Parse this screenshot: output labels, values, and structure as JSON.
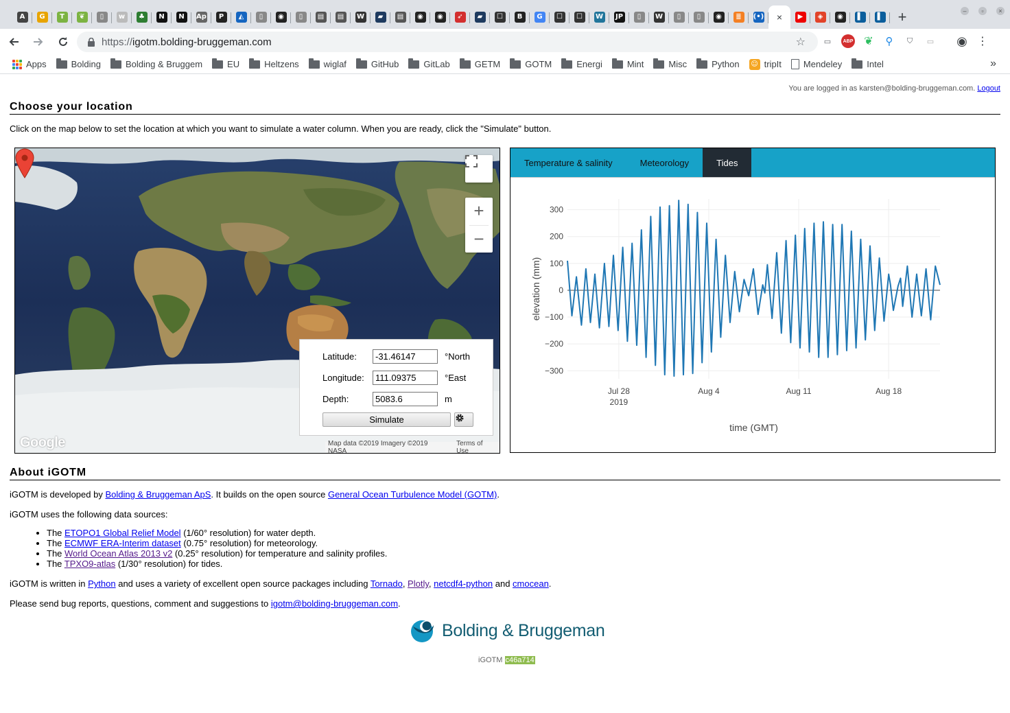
{
  "browser": {
    "tabs": [
      {
        "icon": "A",
        "color": "#444"
      },
      {
        "icon": "G",
        "color": "#e8a400"
      },
      {
        "icon": "T",
        "color": "#7cb342"
      },
      {
        "icon": "❦",
        "color": "#7cb342"
      },
      {
        "icon": "▯",
        "color": "#888"
      },
      {
        "icon": "w",
        "color": "#bbb"
      },
      {
        "icon": "♣",
        "color": "#2e7d32"
      },
      {
        "icon": "N",
        "color": "#111"
      },
      {
        "icon": "N",
        "color": "#111"
      },
      {
        "icon": "Ap",
        "color": "#666"
      },
      {
        "icon": "P",
        "color": "#222"
      },
      {
        "icon": "◭",
        "color": "#1565c0"
      },
      {
        "icon": "▯",
        "color": "#888"
      },
      {
        "icon": "◉",
        "color": "#222"
      },
      {
        "icon": "▯",
        "color": "#888"
      },
      {
        "icon": "▤",
        "color": "#555"
      },
      {
        "icon": "▤",
        "color": "#555"
      },
      {
        "icon": "W",
        "color": "#333"
      },
      {
        "icon": "▰",
        "color": "#1e3a5f"
      },
      {
        "icon": "▤",
        "color": "#555"
      },
      {
        "icon": "◉",
        "color": "#222"
      },
      {
        "icon": "◉",
        "color": "#222"
      },
      {
        "icon": "➶",
        "color": "#d32f2f"
      },
      {
        "icon": "▰",
        "color": "#1e3a5f"
      },
      {
        "icon": "☐",
        "color": "#333"
      },
      {
        "icon": "B",
        "color": "#222"
      },
      {
        "icon": "G",
        "color": "#4285f4"
      },
      {
        "icon": "☐",
        "color": "#333"
      },
      {
        "icon": "☐",
        "color": "#333"
      },
      {
        "icon": "W",
        "color": "#21759b"
      },
      {
        "icon": "JP",
        "color": "#111"
      },
      {
        "icon": "▯",
        "color": "#888"
      },
      {
        "icon": "W",
        "color": "#333"
      },
      {
        "icon": "▯",
        "color": "#888"
      },
      {
        "icon": "▯",
        "color": "#888"
      },
      {
        "icon": "◉",
        "color": "#222"
      },
      {
        "icon": "≣",
        "color": "#f48024"
      },
      {
        "icon": "(•)",
        "color": "#1565c0"
      }
    ],
    "tabs_after_active": [
      {
        "icon": "▶",
        "color": "#e00"
      },
      {
        "icon": "◈",
        "color": "#e24329"
      },
      {
        "icon": "◉",
        "color": "#222"
      },
      {
        "icon": "▌",
        "color": "#0b5e9c"
      },
      {
        "icon": "▌",
        "color": "#0b5e9c"
      }
    ],
    "active_close": "×",
    "new_tab": "+",
    "url_scheme": "https://",
    "url_host": "igotm.bolding-bruggeman.com",
    "bookmarks": [
      {
        "label": "Apps",
        "type": "apps"
      },
      {
        "label": "Bolding",
        "type": "folder"
      },
      {
        "label": "Bolding & Bruggem",
        "type": "folder"
      },
      {
        "label": "EU",
        "type": "folder"
      },
      {
        "label": "Heltzens",
        "type": "folder"
      },
      {
        "label": "wiglaf",
        "type": "folder"
      },
      {
        "label": "GitHub",
        "type": "folder"
      },
      {
        "label": "GitLab",
        "type": "folder"
      },
      {
        "label": "GETM",
        "type": "folder"
      },
      {
        "label": "GOTM",
        "type": "folder"
      },
      {
        "label": "Energi",
        "type": "folder"
      },
      {
        "label": "Mint",
        "type": "folder"
      },
      {
        "label": "Misc",
        "type": "folder"
      },
      {
        "label": "Python",
        "type": "folder"
      },
      {
        "label": "tripIt",
        "type": "tripit"
      },
      {
        "label": "Mendeley",
        "type": "page"
      },
      {
        "label": "Intel",
        "type": "folder"
      }
    ],
    "bookmarks_more": "»"
  },
  "page": {
    "login_text": "You are logged in as karsten@bolding-bruggeman.com.",
    "logout": "Logout",
    "choose_title": "Choose your location",
    "intro": "Click on the map below to set the location at which you want to simulate a water column. When you are ready, click the \"Simulate\" button.",
    "form": {
      "latitude_label": "Latitude:",
      "latitude_value": "-31.46147",
      "latitude_unit": "°North",
      "longitude_label": "Longitude:",
      "longitude_value": "111.09375",
      "longitude_unit": "°East",
      "depth_label": "Depth:",
      "depth_value": "5083.6",
      "depth_unit": "m",
      "simulate": "Simulate"
    },
    "map": {
      "google": "Google",
      "attribution": "Map data ©2019 Imagery ©2019 NASA",
      "terms": "Terms of Use"
    },
    "panel_tabs": [
      {
        "label": "Temperature & salinity",
        "active": false
      },
      {
        "label": "Meteorology",
        "active": false
      },
      {
        "label": "Tides",
        "active": true
      }
    ],
    "about_title": "About iGOTM",
    "about1_pre": "iGOTM is developed by ",
    "about1_link1": "Bolding & Bruggeman ApS",
    "about1_mid": ". It builds on the open source ",
    "about1_link2": "General Ocean Turbulence Model (GOTM)",
    "about1_post": ".",
    "sources_intro": "iGOTM uses the following data sources:",
    "sources": [
      {
        "pre": "The ",
        "link": "ETOPO1 Global Relief Model",
        "post": " (1/60° resolution) for water depth.",
        "visited": false
      },
      {
        "pre": "The ",
        "link": "ECMWF ERA-Interim dataset",
        "post": " (0.75° resolution) for meteorology.",
        "visited": false
      },
      {
        "pre": "The ",
        "link": "World Ocean Atlas 2013 v2",
        "post": " (0.25° resolution) for temperature and salinity profiles.",
        "visited": true
      },
      {
        "pre": "The ",
        "link": "TPXO9-atlas",
        "post": " (1/30° resolution) for tides.",
        "visited": true
      }
    ],
    "written_pre": "iGOTM is written in ",
    "written_python": "Python",
    "written_mid": " and uses a variety of excellent open source packages including ",
    "written_tornado": "Tornado",
    "written_plotly": "Plotly",
    "written_netcdf": "netcdf4-python",
    "written_and": " and ",
    "written_cmocean": "cmocean",
    "bug_pre": "Please send bug reports, questions, comment and suggestions to ",
    "bug_email": "igotm@bolding-bruggeman.com",
    "bug_post": ".",
    "logo_text": "Bolding & Bruggeman",
    "version_label": "iGOTM",
    "version_hash": "c46a714"
  },
  "colors": {
    "tab_bar": "#17a2c8",
    "active_tab": "#222b34",
    "series": "#1f77b4"
  },
  "chart_data": {
    "type": "line",
    "xlabel": "time (GMT)",
    "ylabel": "elevation (mm)",
    "x_ticks": [
      "Jul 28",
      "Aug 4",
      "Aug 11",
      "Aug 18"
    ],
    "x_tick_year": "2019",
    "y_ticks": [
      -300,
      -200,
      -100,
      0,
      100,
      200,
      300
    ],
    "ylim": [
      -330,
      340
    ],
    "x_range_days": [
      "2019-07-24",
      "2019-08-22"
    ],
    "series": [
      {
        "values": [
          [
            0.0,
            110
          ],
          [
            0.25,
            -95
          ],
          [
            0.5,
            50
          ],
          [
            0.78,
            -130
          ],
          [
            1.03,
            80
          ],
          [
            1.28,
            -120
          ],
          [
            1.53,
            60
          ],
          [
            1.78,
            -140
          ],
          [
            2.06,
            100
          ],
          [
            2.31,
            -135
          ],
          [
            2.56,
            130
          ],
          [
            2.82,
            -150
          ],
          [
            3.08,
            160
          ],
          [
            3.34,
            -190
          ],
          [
            3.6,
            175
          ],
          [
            3.86,
            -205
          ],
          [
            4.12,
            225
          ],
          [
            4.38,
            -250
          ],
          [
            4.64,
            275
          ],
          [
            4.9,
            -280
          ],
          [
            5.16,
            310
          ],
          [
            5.42,
            -315
          ],
          [
            5.68,
            315
          ],
          [
            5.94,
            -320
          ],
          [
            6.2,
            335
          ],
          [
            6.46,
            -315
          ],
          [
            6.72,
            320
          ],
          [
            6.98,
            -310
          ],
          [
            7.24,
            290
          ],
          [
            7.5,
            -270
          ],
          [
            7.76,
            250
          ],
          [
            8.02,
            -230
          ],
          [
            8.28,
            190
          ],
          [
            8.54,
            -175
          ],
          [
            8.8,
            130
          ],
          [
            9.06,
            -120
          ],
          [
            9.32,
            70
          ],
          [
            9.58,
            -80
          ],
          [
            9.84,
            40
          ],
          [
            10.1,
            -20
          ],
          [
            10.36,
            80
          ],
          [
            10.62,
            -90
          ],
          [
            10.88,
            20
          ],
          [
            11.0,
            -10
          ],
          [
            11.14,
            95
          ],
          [
            11.4,
            -105
          ],
          [
            11.66,
            140
          ],
          [
            11.92,
            -160
          ],
          [
            12.18,
            185
          ],
          [
            12.44,
            -195
          ],
          [
            12.7,
            205
          ],
          [
            12.96,
            -215
          ],
          [
            13.22,
            230
          ],
          [
            13.48,
            -230
          ],
          [
            13.74,
            250
          ],
          [
            14.0,
            -250
          ],
          [
            14.26,
            255
          ],
          [
            14.52,
            -250
          ],
          [
            14.78,
            245
          ],
          [
            15.04,
            -240
          ],
          [
            15.3,
            245
          ],
          [
            15.56,
            -225
          ],
          [
            15.82,
            220
          ],
          [
            16.08,
            -215
          ],
          [
            16.34,
            190
          ],
          [
            16.6,
            -185
          ],
          [
            16.86,
            165
          ],
          [
            17.12,
            -150
          ],
          [
            17.38,
            120
          ],
          [
            17.64,
            -115
          ],
          [
            17.9,
            60
          ],
          [
            18.0,
            20
          ],
          [
            18.16,
            -75
          ],
          [
            18.42,
            15
          ],
          [
            18.56,
            45
          ],
          [
            18.68,
            -60
          ],
          [
            18.94,
            90
          ],
          [
            19.2,
            -100
          ],
          [
            19.46,
            60
          ],
          [
            19.72,
            -95
          ],
          [
            19.98,
            80
          ],
          [
            20.24,
            -110
          ],
          [
            20.5,
            90
          ],
          [
            20.76,
            20
          ]
        ]
      }
    ]
  }
}
